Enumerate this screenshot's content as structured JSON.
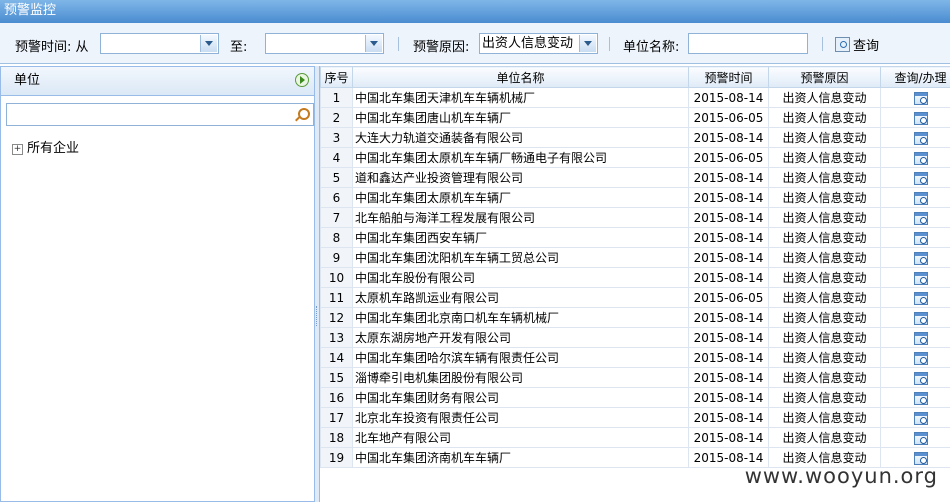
{
  "window": {
    "title": "预警监控"
  },
  "filters": {
    "time_label": "预警时间: 从",
    "from_value": "",
    "to_label": "至:",
    "to_value": "",
    "reason_label": "预警原因:",
    "reason_value": "出资人信息变动",
    "unit_label": "单位名称:",
    "unit_value": "",
    "query_label": "查询"
  },
  "left_panel": {
    "title": "单位",
    "search_value": "",
    "tree_root": "所有企业"
  },
  "grid": {
    "headers": [
      "序号",
      "单位名称",
      "预警时间",
      "预警原因",
      "查询/办理"
    ],
    "rows": [
      {
        "no": "1",
        "name": "中国北车集团天津机车车辆机械厂",
        "date": "2015-08-14",
        "reason": "出资人信息变动"
      },
      {
        "no": "2",
        "name": "中国北车集团唐山机车车辆厂",
        "date": "2015-06-05",
        "reason": "出资人信息变动"
      },
      {
        "no": "3",
        "name": "大连大力轨道交通装备有限公司",
        "date": "2015-08-14",
        "reason": "出资人信息变动"
      },
      {
        "no": "4",
        "name": "中国北车集团太原机车车辆厂畅通电子有限公司",
        "date": "2015-06-05",
        "reason": "出资人信息变动"
      },
      {
        "no": "5",
        "name": "道和鑫达产业投资管理有限公司",
        "date": "2015-08-14",
        "reason": "出资人信息变动"
      },
      {
        "no": "6",
        "name": "中国北车集团太原机车车辆厂",
        "date": "2015-08-14",
        "reason": "出资人信息变动"
      },
      {
        "no": "7",
        "name": "北车船舶与海洋工程发展有限公司",
        "date": "2015-08-14",
        "reason": "出资人信息变动"
      },
      {
        "no": "8",
        "name": "中国北车集团西安车辆厂",
        "date": "2015-08-14",
        "reason": "出资人信息变动"
      },
      {
        "no": "9",
        "name": "中国北车集团沈阳机车车辆工贸总公司",
        "date": "2015-08-14",
        "reason": "出资人信息变动"
      },
      {
        "no": "10",
        "name": "中国北车股份有限公司",
        "date": "2015-08-14",
        "reason": "出资人信息变动"
      },
      {
        "no": "11",
        "name": "太原机车路凯运业有限公司",
        "date": "2015-06-05",
        "reason": "出资人信息变动"
      },
      {
        "no": "12",
        "name": "中国北车集团北京南口机车车辆机械厂",
        "date": "2015-08-14",
        "reason": "出资人信息变动"
      },
      {
        "no": "13",
        "name": "太原东湖房地产开发有限公司",
        "date": "2015-08-14",
        "reason": "出资人信息变动"
      },
      {
        "no": "14",
        "name": "中国北车集团哈尔滨车辆有限责任公司",
        "date": "2015-08-14",
        "reason": "出资人信息变动"
      },
      {
        "no": "15",
        "name": "淄博牵引电机集团股份有限公司",
        "date": "2015-08-14",
        "reason": "出资人信息变动"
      },
      {
        "no": "16",
        "name": "中国北车集团财务有限公司",
        "date": "2015-08-14",
        "reason": "出资人信息变动"
      },
      {
        "no": "17",
        "name": "北京北车投资有限责任公司",
        "date": "2015-08-14",
        "reason": "出资人信息变动"
      },
      {
        "no": "18",
        "name": "北车地产有限公司",
        "date": "2015-08-14",
        "reason": "出资人信息变动"
      },
      {
        "no": "19",
        "name": "中国北车集团济南机车车辆厂",
        "date": "2015-08-14",
        "reason": "出资人信息变动"
      }
    ]
  },
  "watermark": "www.wooyun.org"
}
